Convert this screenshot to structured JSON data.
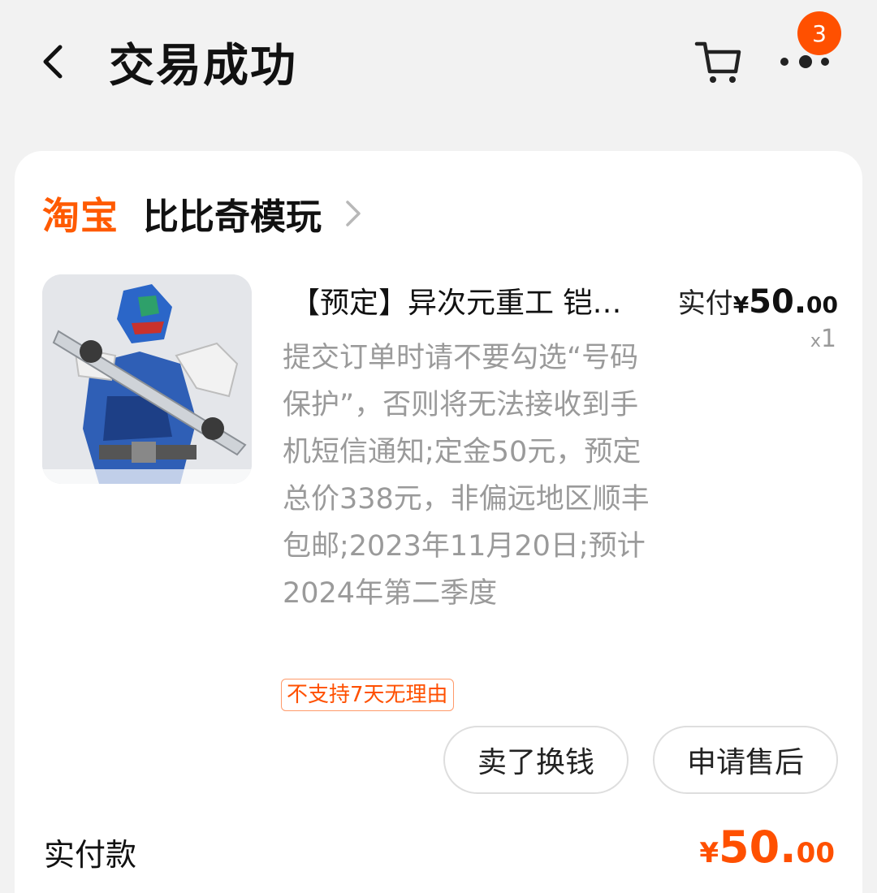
{
  "header": {
    "title": "交易成功",
    "badge_count": "3"
  },
  "shop": {
    "platform_logo": "淘宝",
    "name": "比比奇模玩"
  },
  "item": {
    "title": "【预定】异次元重工 铠…",
    "price_label": "实付",
    "currency": "¥",
    "price_int": "50.",
    "price_dec": "00",
    "qty_prefix": "x",
    "qty": "1",
    "description": "提交订单时请不要勾选“号码保护”，否则将无法接收到手机短信通知;定金50元，预定总价338元，非偏远地区顺丰包邮;2023年11月20日;预计2024年第二季度",
    "tag": "不支持7天无理由"
  },
  "actions": {
    "sell_label": "卖了换钱",
    "after_sale_label": "申请售后"
  },
  "summary": {
    "label": "实付款",
    "currency": "¥",
    "amount_int": "50.",
    "amount_dec": "00"
  },
  "colors": {
    "accent": "#ff5000",
    "background": "#f2f2f2",
    "card": "#ffffff",
    "muted_text": "#9a9a9a"
  },
  "icons": [
    "back-arrow-icon",
    "cart-icon",
    "more-icon",
    "chevron-right-icon"
  ]
}
